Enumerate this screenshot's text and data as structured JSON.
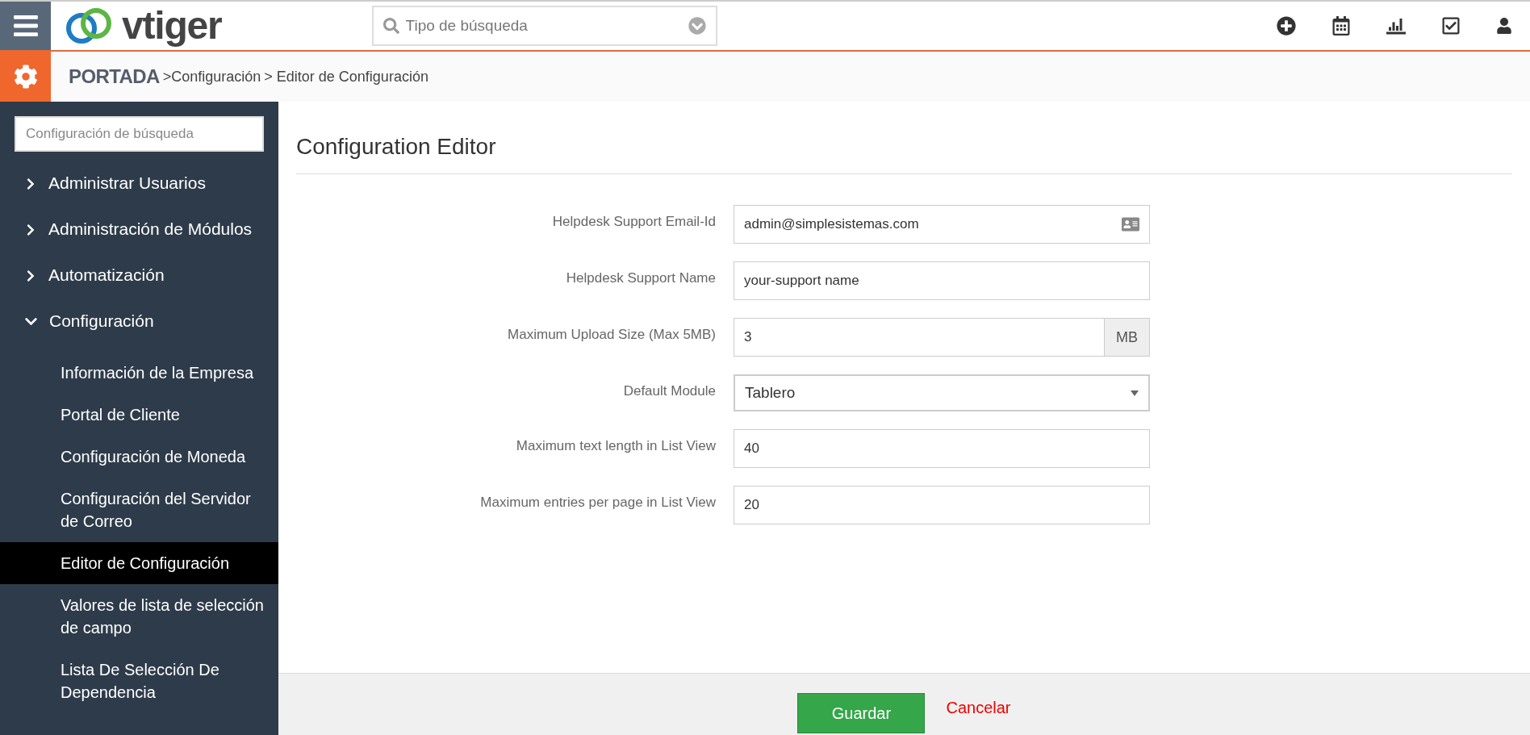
{
  "top_bar": {
    "logo_text": "vtiger",
    "search": {
      "placeholder": "Tipo de búsqueda"
    }
  },
  "breadcrumb": {
    "home": "PORTADA",
    "items": [
      ">Configuración",
      "> Editor de Configuración"
    ]
  },
  "sidebar": {
    "search": {
      "placeholder": "Configuración de búsqueda"
    },
    "items": [
      {
        "label": "Administrar Usuarios",
        "expanded": false
      },
      {
        "label": "Administración de Módulos",
        "expanded": false
      },
      {
        "label": "Automatización",
        "expanded": false
      },
      {
        "label": "Configuración",
        "expanded": true,
        "children": [
          {
            "label": "Información de la Empresa",
            "selected": false
          },
          {
            "label": "Portal de Cliente",
            "selected": false
          },
          {
            "label": "Configuración de Moneda",
            "selected": false
          },
          {
            "label": "Configuración del Servidor de Correo",
            "selected": false
          },
          {
            "label": "Editor de Configuración",
            "selected": true
          },
          {
            "label": "Valores de lista de selección de campo",
            "selected": false
          },
          {
            "label": "Lista De Selección De Dependencia",
            "selected": false
          }
        ]
      }
    ]
  },
  "page": {
    "title": "Configuration Editor",
    "fields": [
      {
        "kind": "contact",
        "label": "Helpdesk Support Email-Id",
        "value": "admin@simplesistemas.com"
      },
      {
        "kind": "text",
        "label": "Helpdesk Support Name",
        "value": "your-support name"
      },
      {
        "kind": "addon",
        "label": "Maximum Upload Size (Max 5MB)",
        "value": "3",
        "addon": "MB"
      },
      {
        "kind": "select",
        "label": "Default Module",
        "value": "Tablero"
      },
      {
        "kind": "text",
        "label": "Maximum text length in List View",
        "value": "40"
      },
      {
        "kind": "text",
        "label": "Maximum entries per page in List View",
        "value": "20"
      }
    ]
  },
  "footer": {
    "save": "Guardar",
    "cancel": "Cancelar"
  }
}
